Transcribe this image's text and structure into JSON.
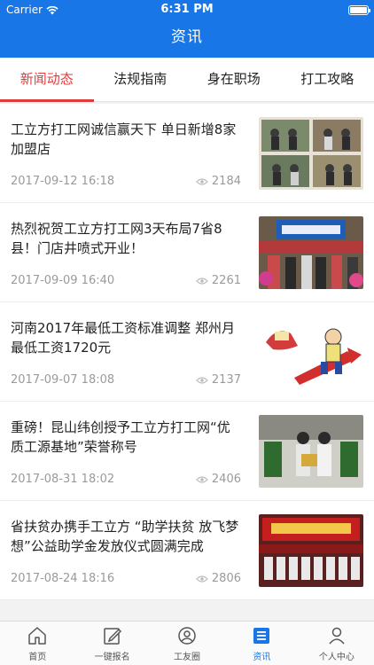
{
  "status": {
    "carrier": "Carrier",
    "time": "6:31 PM"
  },
  "nav": {
    "title": "资讯"
  },
  "tabs": [
    {
      "label": "新闻动态",
      "active": true
    },
    {
      "label": "法规指南"
    },
    {
      "label": "身在职场"
    },
    {
      "label": "打工攻略"
    }
  ],
  "articles": [
    {
      "title": "工立方打工网诚信赢天下 单日新增8家加盟店",
      "date": "2017-09-12 16:18",
      "views": "2184"
    },
    {
      "title": "热烈祝贺工立方打工网3天布局7省8县！门店井喷式开业！",
      "date": "2017-09-09 16:40",
      "views": "2261"
    },
    {
      "title": "河南2017年最低工资标准调整 郑州月最低工资1720元",
      "date": "2017-09-07 18:08",
      "views": "2137"
    },
    {
      "title": "重磅！昆山纬创授予工立方打工网“优质工源基地”荣誉称号",
      "date": "2017-08-31 18:02",
      "views": "2406"
    },
    {
      "title": "省扶贫办携手工立方 “助学扶贫 放飞梦想”公益助学金发放仪式圆满完成",
      "date": "2017-08-24 18:16",
      "views": "2806"
    }
  ],
  "tabbar": [
    {
      "label": "首页",
      "icon": "home-icon"
    },
    {
      "label": "一键报名",
      "icon": "edit-icon"
    },
    {
      "label": "工友圈",
      "icon": "community-icon"
    },
    {
      "label": "资讯",
      "icon": "news-icon",
      "active": true
    },
    {
      "label": "个人中心",
      "icon": "person-icon"
    }
  ],
  "colors": {
    "primary": "#1976e6",
    "accent": "#e03c3c"
  }
}
